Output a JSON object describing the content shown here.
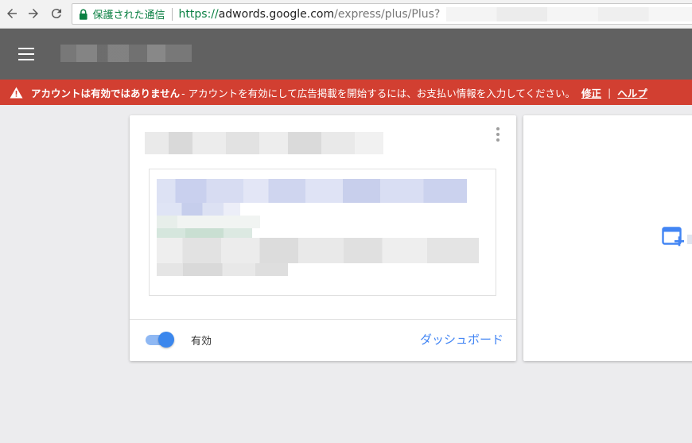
{
  "browser": {
    "secure_label": "保護された通信",
    "url_scheme": "https://",
    "url_host": "adwords.google.com",
    "url_path": "/express/plus/Plus?"
  },
  "alert": {
    "bold_text": "アカウントは有効ではありません",
    "message": " - アカウントを有効にして広告掲載を開始するには、お支払い情報を入力してください。",
    "fix_link": "修正",
    "divider": "|",
    "help_link": "ヘルプ"
  },
  "campaign_card": {
    "toggle_on": true,
    "status_label": "有効",
    "dashboard_link": "ダッシュボード"
  },
  "colors": {
    "alert_red": "#d23f31",
    "header_gray": "#616161",
    "accent_blue": "#4285f4",
    "secure_green": "#0b8043"
  },
  "icons": {
    "back": "arrow-left-icon",
    "forward": "arrow-right-icon",
    "reload": "reload-icon",
    "lock": "lock-icon",
    "menu": "hamburger-menu-icon",
    "warning": "warning-triangle-icon",
    "more": "more-vertical-icon",
    "add_campaign": "add-window-icon"
  }
}
